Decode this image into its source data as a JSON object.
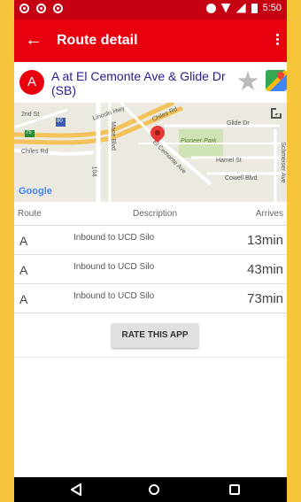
{
  "status_bar": {
    "time": "5:50"
  },
  "appbar": {
    "back_icon": "←",
    "title": "Route detail"
  },
  "stop": {
    "route_letter": "A",
    "name": "A at El Cemonte Ave & Glide Dr (SB)"
  },
  "map": {
    "labels": {
      "street_2nd": "2nd St",
      "lincoln_hwy": "Lincoln Hwy",
      "chiles_rd_top": "Chiles Rd",
      "chiles_rd_left": "Chiles Rd",
      "glide_dr": "Glide Dr",
      "pioneer_park": "Pioneer Park",
      "hamel_st": "Hamel St",
      "cowell_blvd": "Cowell Blvd",
      "el_cemonte_ave": "El Cemonte Ave",
      "mace_blvd": "Mace Blvd",
      "schmeiser_ave": "Schmeiser Ave",
      "hwy_104": "104",
      "shield_75": "75",
      "shield_80": "80"
    },
    "attribution": "Google"
  },
  "arrivals": {
    "headers": {
      "route": "Route",
      "description": "Description",
      "arrives": "Arrives"
    },
    "rows": [
      {
        "route": "A",
        "description": "Inbound to UCD Silo",
        "arrives": "13min"
      },
      {
        "route": "A",
        "description": "Inbound to UCD Silo",
        "arrives": "43min"
      },
      {
        "route": "A",
        "description": "Inbound to UCD Silo",
        "arrives": "73min"
      }
    ]
  },
  "rate_button": "RATE THIS APP",
  "colors": {
    "primary": "#e8000f",
    "primary_dark": "#c40012",
    "background": "#f7c53a"
  }
}
